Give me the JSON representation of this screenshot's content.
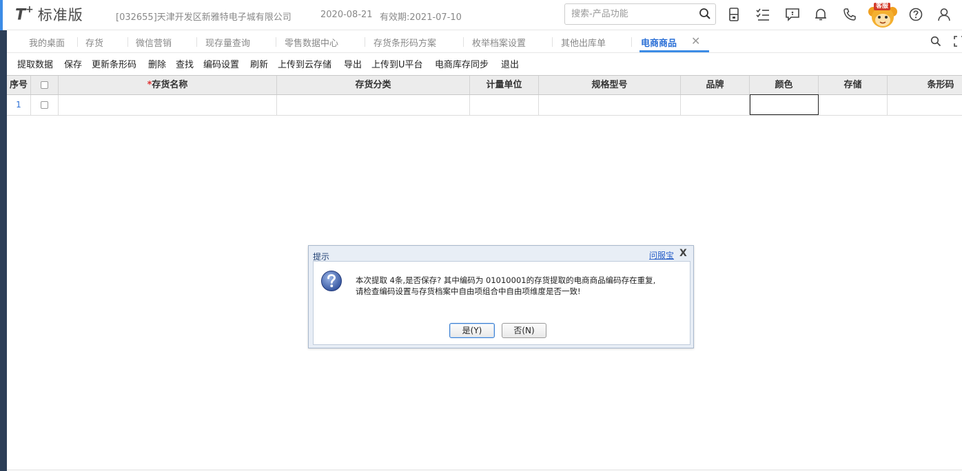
{
  "header": {
    "logo_mark": "T",
    "logo_plus": "+",
    "logo_name": "标准版",
    "company": "[032655]天津开发区新雅特电子城有限公司",
    "date": "2020-08-21",
    "validity": "有效期:2021-07-10",
    "search_placeholder": "搜索-产品功能",
    "mascot_label": "客服",
    "icons": [
      "calculator-icon",
      "tasks-icon",
      "message-icon",
      "bell-icon",
      "phone-icon",
      "help-icon",
      "user-icon"
    ]
  },
  "tabs": [
    {
      "label": "我的桌面"
    },
    {
      "label": "存货"
    },
    {
      "label": "微信营销"
    },
    {
      "label": "现存量查询"
    },
    {
      "label": "零售数据中心"
    },
    {
      "label": "存货条形码方案"
    },
    {
      "label": "枚举档案设置"
    },
    {
      "label": "其他出库单"
    },
    {
      "label": "电商商品",
      "active": true
    }
  ],
  "toolbar": {
    "items": [
      "提取数据",
      "保存",
      "更新条形码",
      "删除",
      "查找",
      "编码设置",
      "刷新",
      "上传到云存储",
      "导出",
      "上传到U平台",
      "电商库存同步",
      "退出"
    ]
  },
  "grid": {
    "columns": [
      "序号",
      "",
      "存货名称",
      "存货分类",
      "计量单位",
      "规格型号",
      "品牌",
      "颜色",
      "存储",
      "条形码"
    ],
    "required_mark": "*",
    "rows": [
      {
        "index": "1",
        "checked": false,
        "cells": [
          "",
          "",
          "",
          "",
          "",
          "",
          "",
          ""
        ]
      }
    ]
  },
  "dialog": {
    "title": "提示",
    "help_link": "问服宝",
    "close": "X",
    "message_line1": "本次提取 4条,是否保存? 其中编码为 01010001的存货提取的电商商品编码存在重复,",
    "message_line2": "请检查编码设置与存货档案中自由项组合中自由项维度是否一致!",
    "yes_label": "是(Y)",
    "no_label": "否(N)"
  },
  "colors": {
    "accent": "#3c8ce6",
    "active_tab_text": "#2a6fd6",
    "left_rail": "#2c3e57",
    "grid_header_bg": "#ececec",
    "dialog_frame": "#e8eef6",
    "required_mark": "#e03030"
  }
}
